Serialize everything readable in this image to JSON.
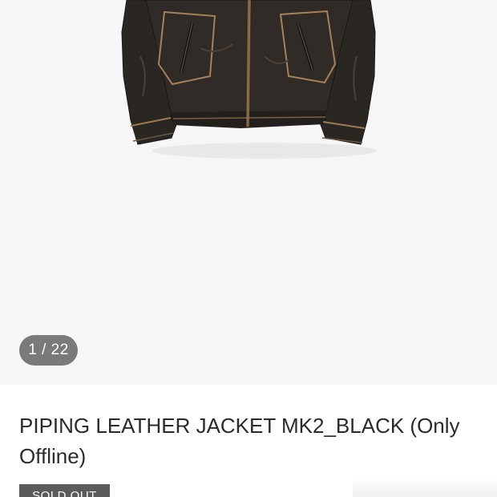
{
  "gallery": {
    "image_alt": "PIPING LEATHER JACKET MK2_BLACK",
    "counter_text": "1 / 22",
    "current_index": 1,
    "total_images": 22
  },
  "product": {
    "title": "PIPING LEATHER JACKET MK2_BLACK (Only Offline)",
    "status_badge": "SOLD OUT"
  },
  "colors": {
    "gallery_background": "#f6f6f6",
    "counter_background": "#7a7a7a",
    "badge_background": "#5b5b5b",
    "title_text": "#2b2b2b"
  }
}
